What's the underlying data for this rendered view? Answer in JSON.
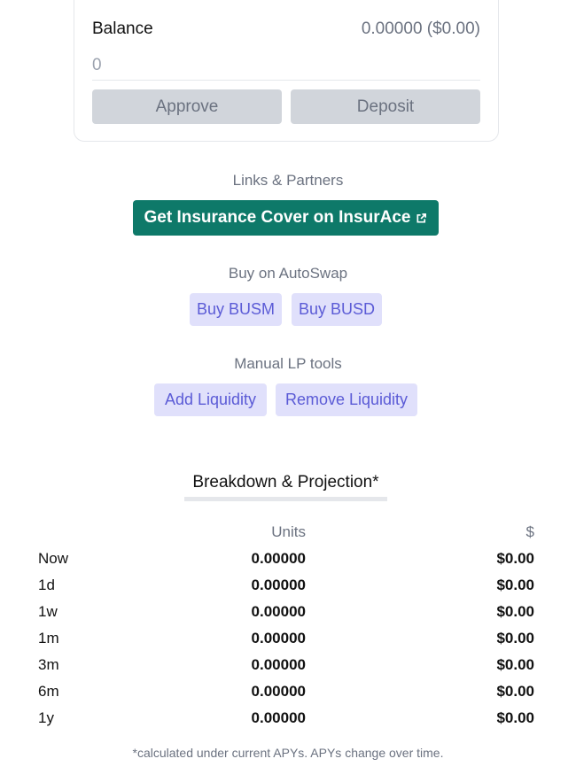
{
  "deposit_card": {
    "balance_label": "Balance",
    "balance_value": "0.00000 ($0.00)",
    "amount_placeholder": "0",
    "approve_label": "Approve",
    "deposit_label": "Deposit"
  },
  "links": {
    "title": "Links & Partners",
    "insurance_label": "Get Insurance Cover on InsurAce"
  },
  "autoswap": {
    "title": "Buy on AutoSwap",
    "buy_busm_label": "Buy BUSM",
    "buy_busd_label": "Buy BUSD"
  },
  "lp_tools": {
    "title": "Manual LP tools",
    "add_liquidity_label": "Add Liquidity",
    "remove_liquidity_label": "Remove Liquidity"
  },
  "breakdown": {
    "title": "Breakdown & Projection*",
    "headers": {
      "period": "",
      "units": "Units",
      "usd": "$"
    },
    "rows": [
      {
        "period": "Now",
        "units": "0.00000",
        "usd": "$0.00"
      },
      {
        "period": "1d",
        "units": "0.00000",
        "usd": "$0.00"
      },
      {
        "period": "1w",
        "units": "0.00000",
        "usd": "$0.00"
      },
      {
        "period": "1m",
        "units": "0.00000",
        "usd": "$0.00"
      },
      {
        "period": "3m",
        "units": "0.00000",
        "usd": "$0.00"
      },
      {
        "period": "6m",
        "units": "0.00000",
        "usd": "$0.00"
      },
      {
        "period": "1y",
        "units": "0.00000",
        "usd": "$0.00"
      }
    ],
    "footnote": "*calculated under current APYs. APYs change over time."
  },
  "icons": {
    "external_link": "external-link-icon"
  },
  "colors": {
    "teal": "#0e7969",
    "purple_bg": "#e0e0fb",
    "purple_text": "#5b5bd6",
    "gray_button": "#d1d5db"
  }
}
